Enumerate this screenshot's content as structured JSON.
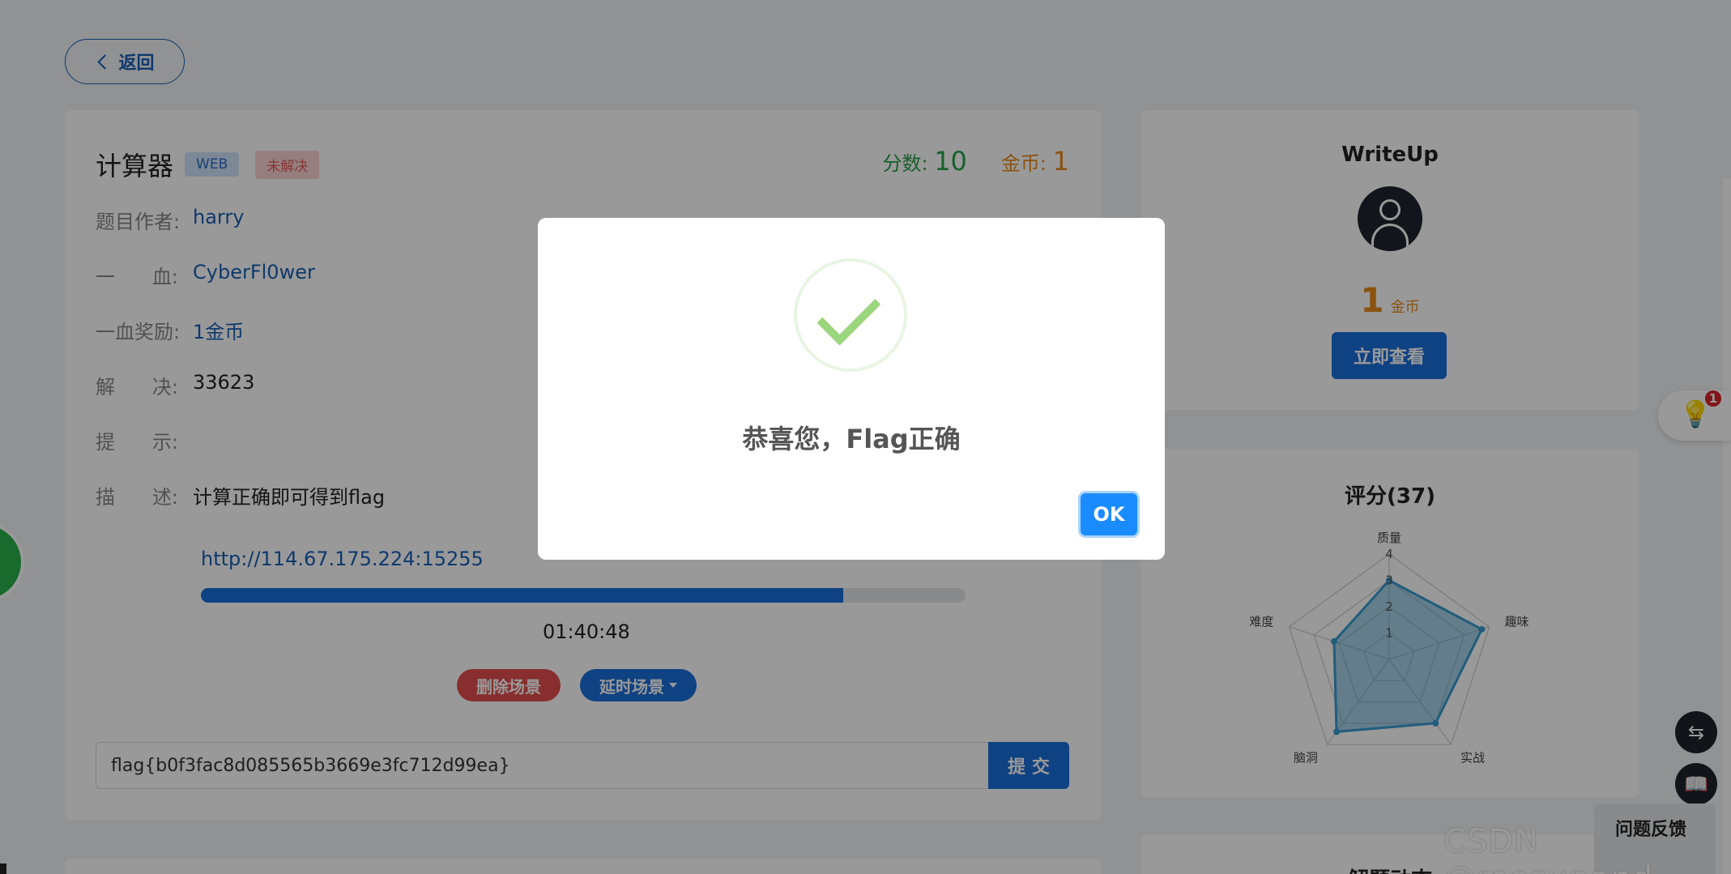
{
  "back": {
    "label": "返回"
  },
  "challenge": {
    "title": "计算器",
    "tags": [
      "WEB",
      "未解决"
    ],
    "score_label": "分数:",
    "score": "10",
    "coin_label": "金币:",
    "coin": "1",
    "author_label": "题目作者:",
    "author": "harry",
    "blood_label_a": "一",
    "blood_label_b": "血:",
    "blood": "CyberFl0wer",
    "reward_label": "一血奖励:",
    "reward": "1金币",
    "solved_label_a": "解",
    "solved_label_b": "决:",
    "solved": "33623",
    "hint_label_a": "提",
    "hint_label_b": "示:",
    "desc_label_a": "描",
    "desc_label_b": "述:",
    "desc": "计算正确即可得到flag",
    "url": "http://114.67.175.224:15255",
    "progress_fraction": 0.84,
    "timer": "01:40:48",
    "delete_scene": "删除场景",
    "extend_scene": "延时场景",
    "flag_value": "flag{b0f3fac8d085565b3669e3fc712d99ea}",
    "submit": "提 交"
  },
  "writeup": {
    "title": "WriteUp",
    "coins": "1",
    "coins_unit": "金币",
    "view": "立即查看"
  },
  "rating": {
    "title": "评分(37)"
  },
  "chart_data": {
    "type": "radar",
    "title": "评分(37)",
    "axes": [
      "质量",
      "趣味",
      "实战",
      "脑洞",
      "难度"
    ],
    "ticks": [
      "1",
      "2",
      "3",
      "4"
    ],
    "range": [
      0,
      4
    ],
    "series": [
      {
        "values": [
          3.0,
          3.7,
          3.0,
          3.4,
          2.2
        ]
      }
    ]
  },
  "solve_section": {
    "title": "解题动态"
  },
  "floating": {
    "badge": "1",
    "feedback": "问题反馈"
  },
  "watermark": "CSDN @mosunand",
  "modal": {
    "message": "恭喜您，Flag正确",
    "ok": "OK"
  },
  "colors": {
    "primary": "#1a6fd9",
    "success": "#27a04a",
    "coin": "#e68a1c",
    "danger": "#e34d4d"
  },
  "icons": [
    "chevron-left-icon",
    "user-avatar-icon",
    "lightbulb-icon",
    "translate-icon",
    "book-icon",
    "check-icon"
  ]
}
